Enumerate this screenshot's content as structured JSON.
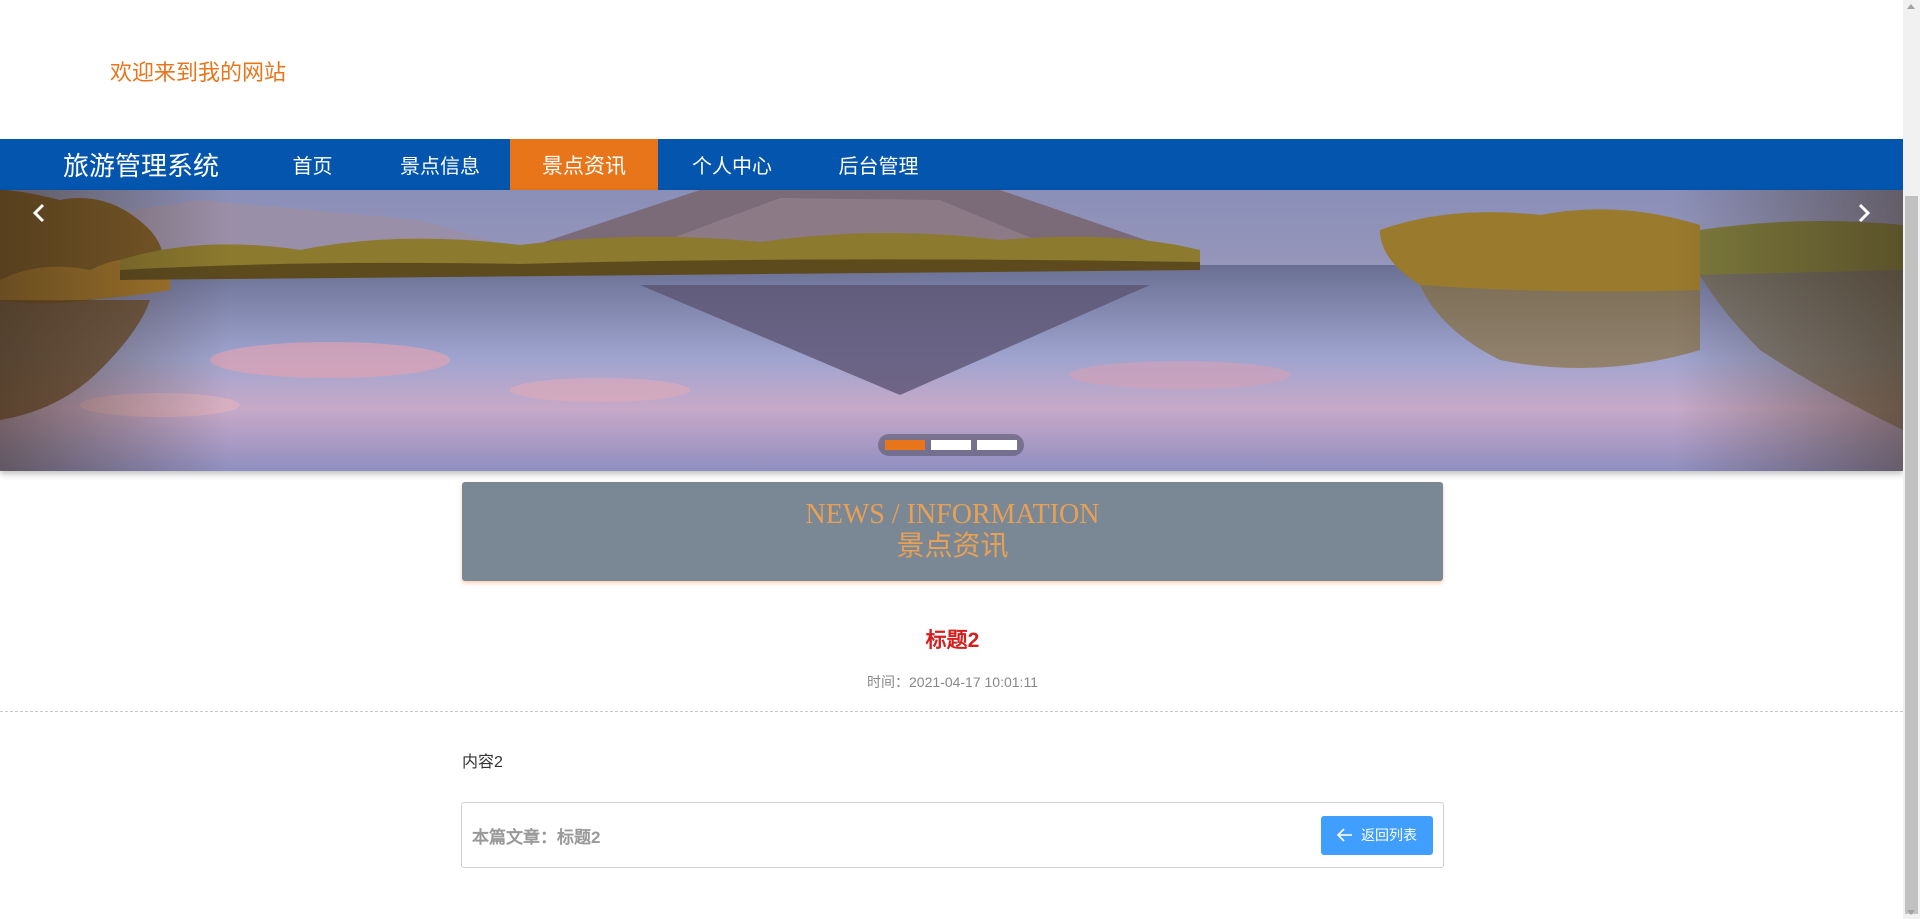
{
  "header": {
    "welcome": "欢迎来到我的网站"
  },
  "nav": {
    "brand": "旅游管理系统",
    "items": [
      {
        "label": "首页",
        "active": false
      },
      {
        "label": "景点信息",
        "active": false
      },
      {
        "label": "景点资讯",
        "active": true
      },
      {
        "label": "个人中心",
        "active": false
      },
      {
        "label": "后台管理",
        "active": false
      }
    ]
  },
  "banner": {
    "prev_icon": "chevron-left-icon",
    "next_icon": "chevron-right-icon",
    "dots": 3,
    "active_dot": 0,
    "image": "mountain-lake-reflection"
  },
  "section": {
    "title_en": "NEWS / INFORMATION",
    "title_zh": "景点资讯"
  },
  "article": {
    "title": "标题2",
    "time": "时间：2021-04-17 10:01:11",
    "content": "内容2",
    "footer_label": "本篇文章：标题2",
    "back_label": "返回列表",
    "back_icon": "arrow-left-icon"
  },
  "colors": {
    "accent": "#e8751a",
    "nav_bg": "#0355ae",
    "title_red": "#d41f1f",
    "button_blue": "#409eff",
    "section_bg": "#7a8896"
  }
}
